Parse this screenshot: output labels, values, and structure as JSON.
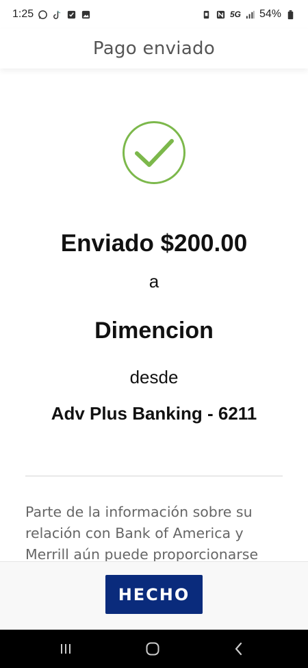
{
  "status_bar": {
    "time": "1:25",
    "network": "5G",
    "battery": "54%",
    "icons": [
      "whatsapp-icon",
      "tiktok-icon",
      "checkbox-icon",
      "gallery-icon",
      "alarm-icon",
      "nfc-icon",
      "signal-icon",
      "battery-icon"
    ]
  },
  "header": {
    "title": "Pago enviado"
  },
  "confirmation": {
    "icon": "checkmark-circle-icon",
    "sent_amount": "Enviado $200.00",
    "connector_a": "a",
    "recipient": "Dimencion",
    "connector_desde": "desde",
    "account": "Adv Plus Banking - 6211"
  },
  "disclaimer": {
    "text": "Parte de la información sobre su relación con Bank of America y Merrill aún puede proporcionarse"
  },
  "footer": {
    "done_label": "HECHO"
  },
  "nav_bar": {
    "icons": [
      "recents-icon",
      "home-icon",
      "back-icon"
    ]
  },
  "colors": {
    "check_green": "#7cb84b",
    "button_blue": "#0a2b7c",
    "title_gray": "#555555",
    "disclaimer_gray": "#666666"
  }
}
